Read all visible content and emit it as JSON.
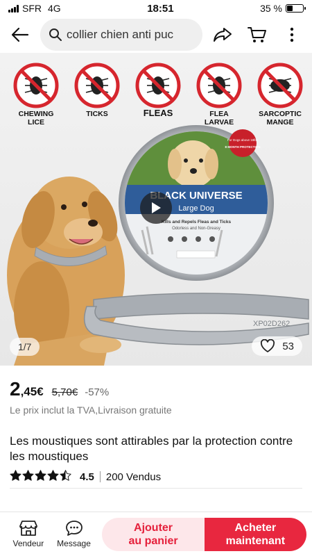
{
  "status": {
    "carrier": "SFR",
    "network": "4G",
    "time": "18:51",
    "battery": "35 %",
    "battery_level": 0.35
  },
  "search": {
    "query": "collier chien anti puc"
  },
  "gallery": {
    "pests": [
      "CHEWING\nLICE",
      "TICKS",
      "FLEAS",
      "FLEA\nLARVAE",
      "SARCOPTIC\nMANGE"
    ],
    "tin_brand": "BLACK UNIVERSE",
    "tin_size": "Large Dog",
    "tin_sub1": "Kills and Repels Fleas and Ticks",
    "tin_sub2": "Odorless and Non-Greasy",
    "tin_badge1": "For Dogs above 18lbs",
    "tin_badge2": "8 MONTH PROTECTION",
    "collar_code": "XP02D262",
    "counter": "1/7",
    "likes": "53"
  },
  "product": {
    "price_int": "2",
    "price_dec": ",45€",
    "price_old": "5,70€",
    "discount": "-57%",
    "price_note": "Le prix inclut la TVA,Livraison gratuite",
    "title": "Les moustiques sont attirables par la protection contre les moustiques",
    "rating": "4.5",
    "rating_value": 4.5,
    "sold": "200 Vendus"
  },
  "bottom": {
    "seller_label": "Vendeur",
    "message_label": "Message",
    "add_cart": "Ajouter\nau panier",
    "buy_now": "Acheter\nmaintenant"
  },
  "colors": {
    "accent": "#e8273f",
    "accent_light": "#fde7ea",
    "prohibit_red": "#d6262e",
    "collar_gray": "#a8adb3",
    "tin_blue": "#2f5d9a"
  }
}
